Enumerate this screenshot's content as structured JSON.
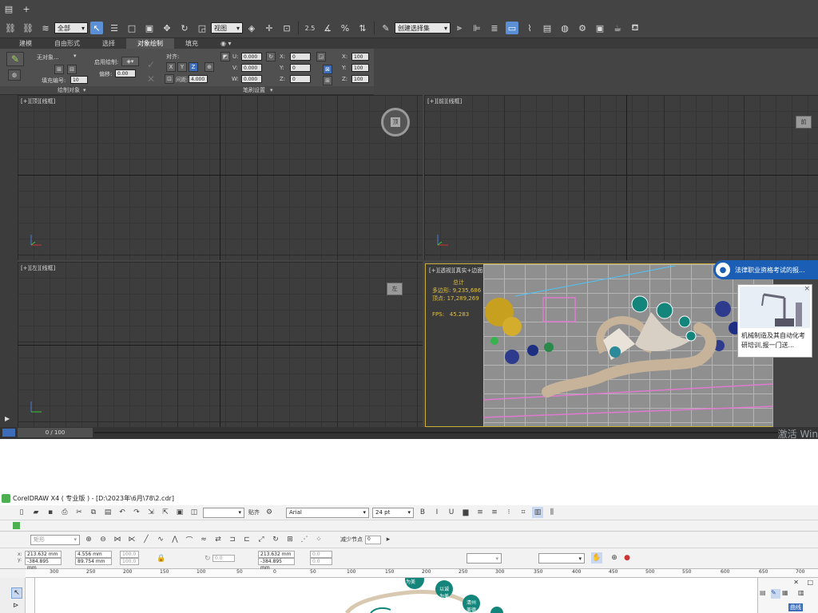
{
  "max": {
    "toolbar": {
      "selection_filter": "全部",
      "ref_coord": "视图",
      "snap_angle": "2.5",
      "named_sel": "创建选择集"
    },
    "ribbon_tabs": [
      "建模",
      "自由形式",
      "选择",
      "对象绘制",
      "填充",
      "◉ ▾"
    ],
    "active_tab": 3,
    "panel": {
      "object_label": "无对象...",
      "fill_number_label": "填充编号:",
      "fill_number_value": "10",
      "enable_draw_label": "启用绘制:",
      "offset_label": "偏移:",
      "offset_value": "0.00",
      "align_label": "对齐:",
      "x_btn": "X",
      "y_btn": "Y",
      "z_btn": "Z",
      "spacing_label": "间距:",
      "spacing_value": "4.000",
      "u_label": "U:",
      "v_label": "V:",
      "w_label": "W:",
      "u_value": "0.000",
      "v_value": "0.000",
      "w_value": "0.000",
      "rx_label": "X:",
      "ry_label": "Y:",
      "rz_label": "Z:",
      "rx_value": "0",
      "ry_value": "0",
      "rz_value": "0",
      "sx_label": "X:",
      "sy_label": "Y:",
      "sz_label": "Z:",
      "sx_value": "100",
      "sy_value": "100",
      "sz_value": "100",
      "footer_left": "绘制对象",
      "footer_right": "笔刷设置"
    },
    "viewports": {
      "top": "[+][顶][线框]",
      "front": "[+][前][线框]",
      "left": "[+][左][线框]",
      "persp": "[+][透视][真实+边面]"
    },
    "viewcube_labels": {
      "top": "顶",
      "front": "前",
      "left": "左"
    },
    "stats": {
      "title": "总计",
      "poly_label": "多边形:",
      "poly_value": "9,235,686",
      "vert_label": "顶点:",
      "vert_value": "17,289,269",
      "fps_label": "FPS:",
      "fps_value": "45.283"
    },
    "timeline": "0 / 100",
    "activate_text": "激活 Win",
    "ad": {
      "header": "法律职业资格考试的报...",
      "body": "机械制造及其自动化考研培训,报一门送...",
      "close": "×"
    }
  },
  "corel": {
    "title": "CorelDRAW X4 ( 专业版 ) - [D:\\2023年\\6月\\78\\2.cdr]",
    "snap_label": "贴齐",
    "font_name": "Arial",
    "font_size": "24 pt",
    "shape_select": "矩形",
    "node_label": "减少节点",
    "node_value": "0",
    "x_label": "x:",
    "y_label": "y:",
    "x_value": "213.632 mm",
    "y_value": "-384.895 mm",
    "w_value": "4.556 mm",
    "h_value": "89.754 mm",
    "scale_x": "100.0",
    "scale_y": "100.0",
    "rotation": "0.0",
    "x2_value": "213.632 mm",
    "y2_value": "-384.895 mm",
    "r1": "0.0",
    "r2": "0.0",
    "ruler_ticks": [
      "300",
      "250",
      "200",
      "150",
      "100",
      "50",
      "0",
      "50",
      "100",
      "150",
      "200",
      "250",
      "300",
      "350",
      "400",
      "450",
      "500",
      "550",
      "600",
      "650",
      "700"
    ],
    "ruler_unit": "毫米",
    "docker_label": "曲线",
    "badges": [
      "以德为美",
      "以诚为美",
      "清州美德",
      "为美"
    ]
  },
  "colors": {
    "max_bg": "#444444",
    "accent_blue": "#5b8fd6",
    "persp_border": "#c8b03a",
    "stats_yellow": "#e0c046",
    "ad_blue": "#1a5fb5",
    "teal": "#14857a"
  }
}
